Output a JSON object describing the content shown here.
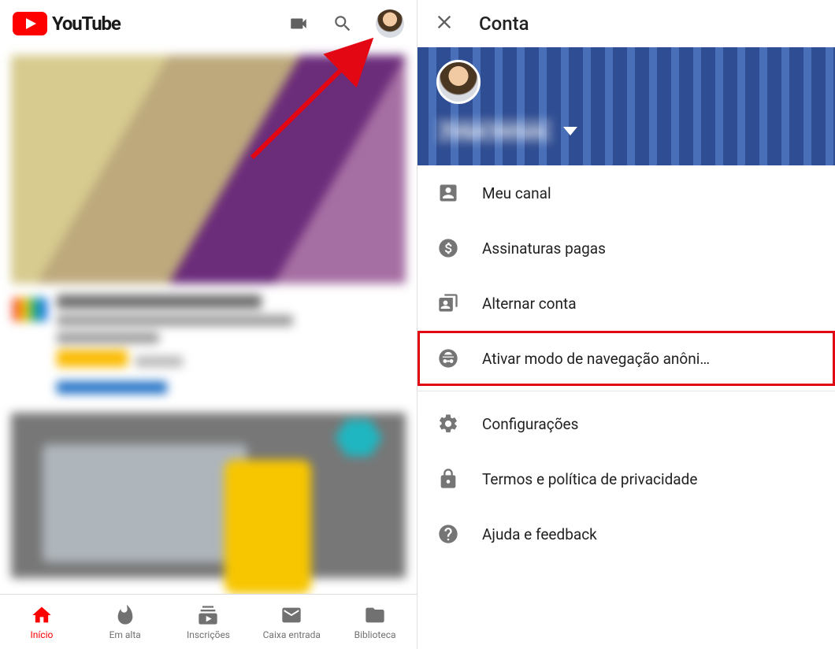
{
  "header": {
    "logo_text": "YouTube"
  },
  "bottom_nav": {
    "home": "Início",
    "trending": "Em alta",
    "subs": "Inscrições",
    "inbox": "Caixa entrada",
    "library": "Biblioteca"
  },
  "account_panel": {
    "title": "Conta",
    "user_name": "Felipe Ventura",
    "menu": {
      "my_channel": "Meu canal",
      "paid": "Assinaturas pagas",
      "switch": "Alternar conta",
      "incognito": "Ativar modo de navegação anôni…",
      "settings": "Configurações",
      "terms": "Termos e política de privacidade",
      "help": "Ajuda e feedback"
    }
  }
}
